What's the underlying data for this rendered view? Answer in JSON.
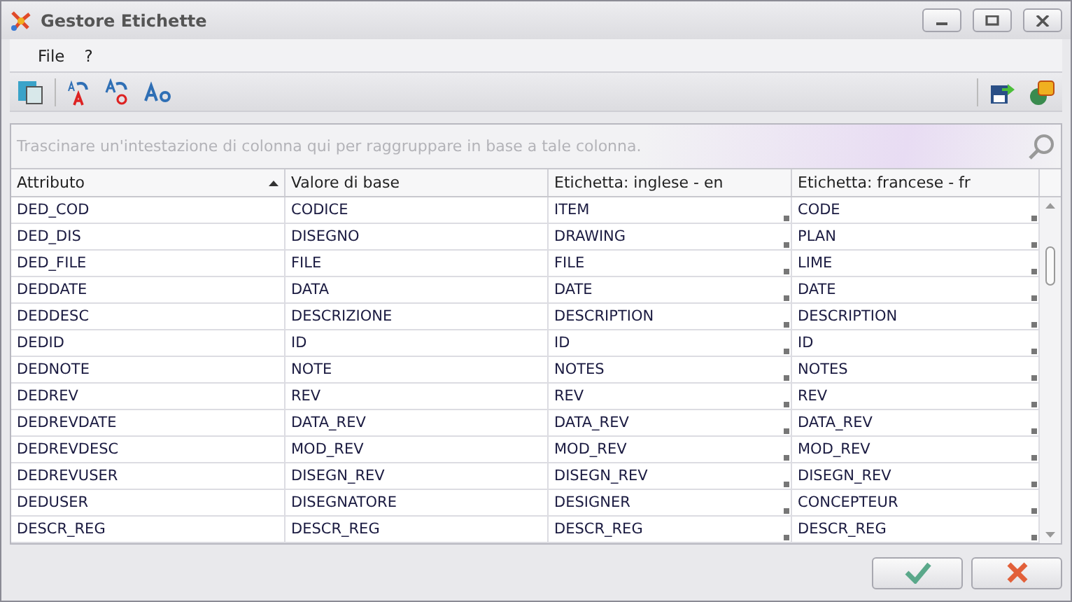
{
  "window": {
    "title": "Gestore Etichette"
  },
  "menu": [
    "File",
    "?"
  ],
  "group_panel": {
    "placeholder": "Trascinare un'intestazione di colonna qui per raggruppare in base a tale colonna."
  },
  "table": {
    "columns": [
      {
        "label": "Attributo",
        "sorted": true
      },
      {
        "label": "Valore di base",
        "sorted": false
      },
      {
        "label": "Etichetta: inglese - en",
        "sorted": false
      },
      {
        "label": "Etichetta: francese - fr",
        "sorted": false
      }
    ],
    "rows": [
      [
        "DED_COD",
        "CODICE",
        "ITEM",
        "CODE"
      ],
      [
        "DED_DIS",
        "DISEGNO",
        "DRAWING",
        "PLAN"
      ],
      [
        "DED_FILE",
        "FILE",
        "FILE",
        "LIME"
      ],
      [
        "DEDDATE",
        "DATA",
        "DATE",
        "DATE"
      ],
      [
        "DEDDESC",
        "DESCRIZIONE",
        "DESCRIPTION",
        "DESCRIPTION"
      ],
      [
        "DEDID",
        "ID",
        "ID",
        "ID"
      ],
      [
        "DEDNOTE",
        "NOTE",
        "NOTES",
        "NOTES"
      ],
      [
        "DEDREV",
        "REV",
        "REV",
        "REV"
      ],
      [
        "DEDREVDATE",
        "DATA_REV",
        "DATA_REV",
        "DATA_REV"
      ],
      [
        "DEDREVDESC",
        "MOD_REV",
        "MOD_REV",
        "MOD_REV"
      ],
      [
        "DEDREVUSER",
        "DISEGN_REV",
        "DISEGN_REV",
        "DISEGN_REV"
      ],
      [
        "DEDUSER",
        "DISEGNATORE",
        "DESIGNER",
        "CONCEPTEUR"
      ],
      [
        "DESCR_REG",
        "DESCR_REG",
        "DESCR_REG",
        "DESCR_REG"
      ]
    ]
  }
}
